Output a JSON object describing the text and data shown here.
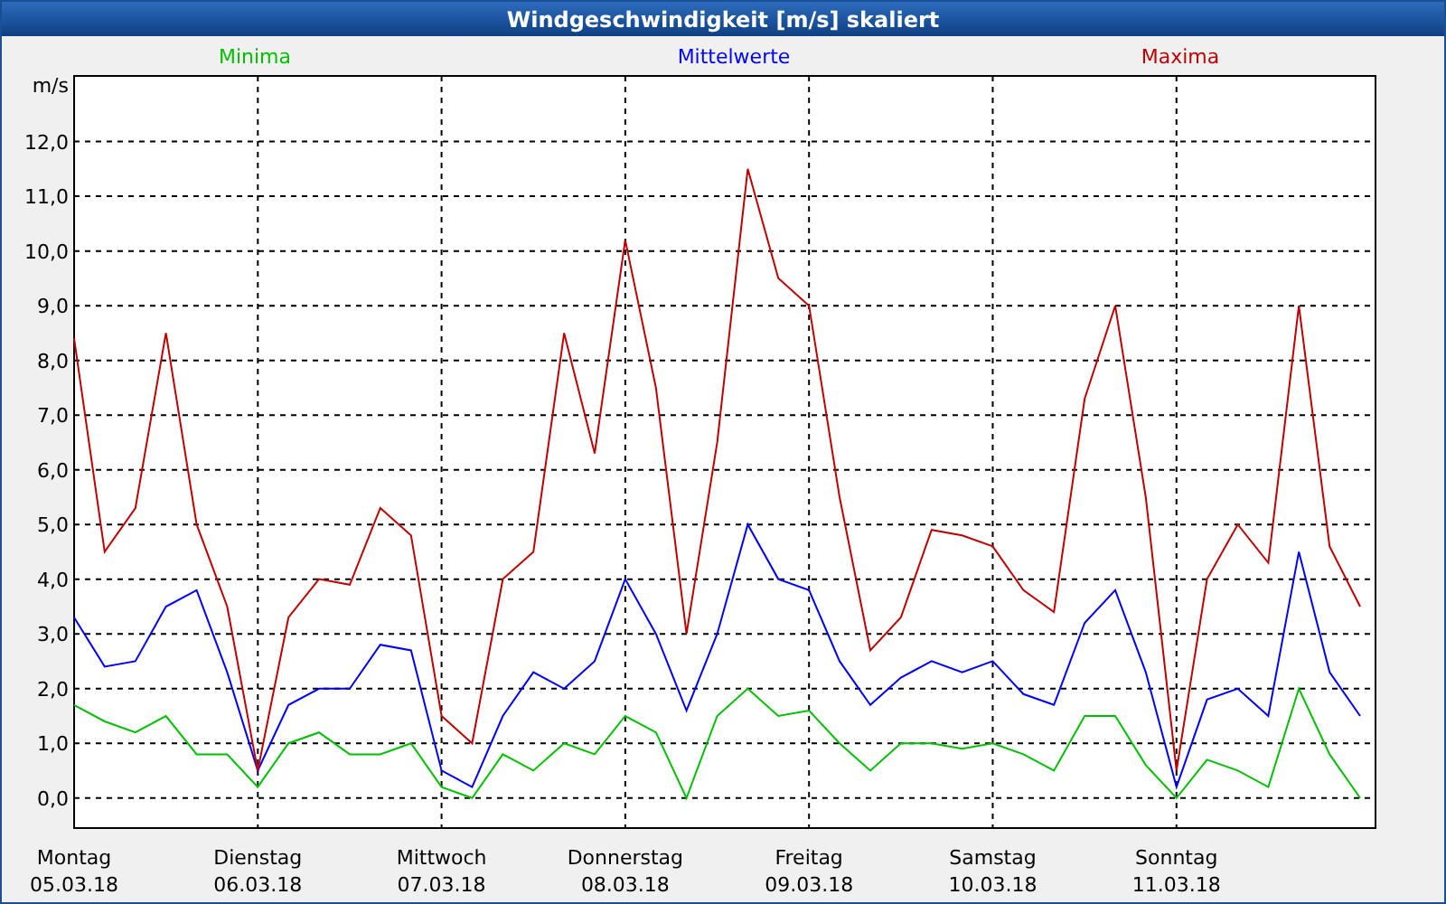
{
  "window": {
    "title": "Windgeschwindigkeit [m/s] skaliert"
  },
  "chart": {
    "chart_data": {
      "type": "line",
      "grid": true,
      "ylabel": "m/s",
      "categories": [
        "Montag\n05.03.18",
        null,
        null,
        null,
        null,
        null,
        "Dienstag\n06.03.18",
        null,
        null,
        null,
        null,
        null,
        "Mittwoch\n07.03.18",
        null,
        null,
        null,
        null,
        null,
        "Donnerstag\n08.03.18",
        null,
        null,
        null,
        null,
        null,
        "Freitag\n09.03.18",
        null,
        null,
        null,
        null,
        null,
        "Samstag\n10.03.18",
        null,
        null,
        null,
        null,
        null,
        "Sonntag\n11.03.18",
        null,
        null,
        null,
        null,
        null,
        null
      ],
      "series": [
        {
          "name": "Minima",
          "color": "#00c000",
          "values": [
            1.7,
            1.4,
            1.2,
            1.5,
            0.8,
            0.8,
            0.2,
            1.0,
            1.2,
            0.8,
            0.8,
            1.0,
            0.2,
            0.0,
            0.8,
            0.5,
            1.0,
            0.8,
            1.5,
            1.2,
            0.0,
            1.5,
            2.0,
            1.5,
            1.6,
            1.0,
            0.5,
            1.0,
            1.0,
            0.9,
            1.0,
            0.8,
            0.5,
            1.5,
            1.5,
            0.6,
            0.0,
            0.7,
            0.5,
            0.2,
            2.0,
            0.8,
            0.0
          ]
        },
        {
          "name": "Mittelwerte",
          "color": "#0000ff",
          "values": [
            3.3,
            2.4,
            2.5,
            3.5,
            3.8,
            2.3,
            0.5,
            1.7,
            2.0,
            2.0,
            2.8,
            2.7,
            0.5,
            0.2,
            1.5,
            2.3,
            2.0,
            2.5,
            4.0,
            3.0,
            1.6,
            3.0,
            5.0,
            4.0,
            3.8,
            2.5,
            1.7,
            2.2,
            2.5,
            2.3,
            2.5,
            1.9,
            1.7,
            3.2,
            3.8,
            2.3,
            0.2,
            1.8,
            2.0,
            1.5,
            4.5,
            2.3,
            1.5
          ]
        },
        {
          "name": "Maxima",
          "color": "#c00000",
          "values": [
            8.4,
            4.5,
            5.3,
            8.5,
            5.0,
            3.5,
            0.5,
            3.3,
            4.0,
            3.9,
            5.3,
            4.8,
            1.5,
            1.0,
            4.0,
            4.5,
            8.5,
            6.3,
            10.2,
            7.5,
            3.0,
            6.5,
            11.5,
            9.5,
            9.0,
            5.5,
            2.7,
            3.3,
            4.9,
            4.8,
            4.6,
            3.8,
            3.4,
            7.3,
            9.0,
            5.5,
            0.5,
            4.0,
            5.0,
            4.3,
            9.0,
            4.6,
            3.5
          ]
        }
      ],
      "ylim": [
        -0.55,
        13.2
      ],
      "yticks": [
        {
          "value": 0,
          "label": "0,0"
        },
        {
          "value": 1,
          "label": "1,0"
        },
        {
          "value": 2,
          "label": "2,0"
        },
        {
          "value": 3,
          "label": "3,0"
        },
        {
          "value": 4,
          "label": "4,0"
        },
        {
          "value": 5,
          "label": "5,0"
        },
        {
          "value": 6,
          "label": "6,0"
        },
        {
          "value": 7,
          "label": "7,0"
        },
        {
          "value": 8,
          "label": "8,0"
        },
        {
          "value": 9,
          "label": "9,0"
        },
        {
          "value": 10,
          "label": "10,0"
        },
        {
          "value": 11,
          "label": "11,0"
        },
        {
          "value": 12,
          "label": "12,0"
        }
      ]
    }
  }
}
